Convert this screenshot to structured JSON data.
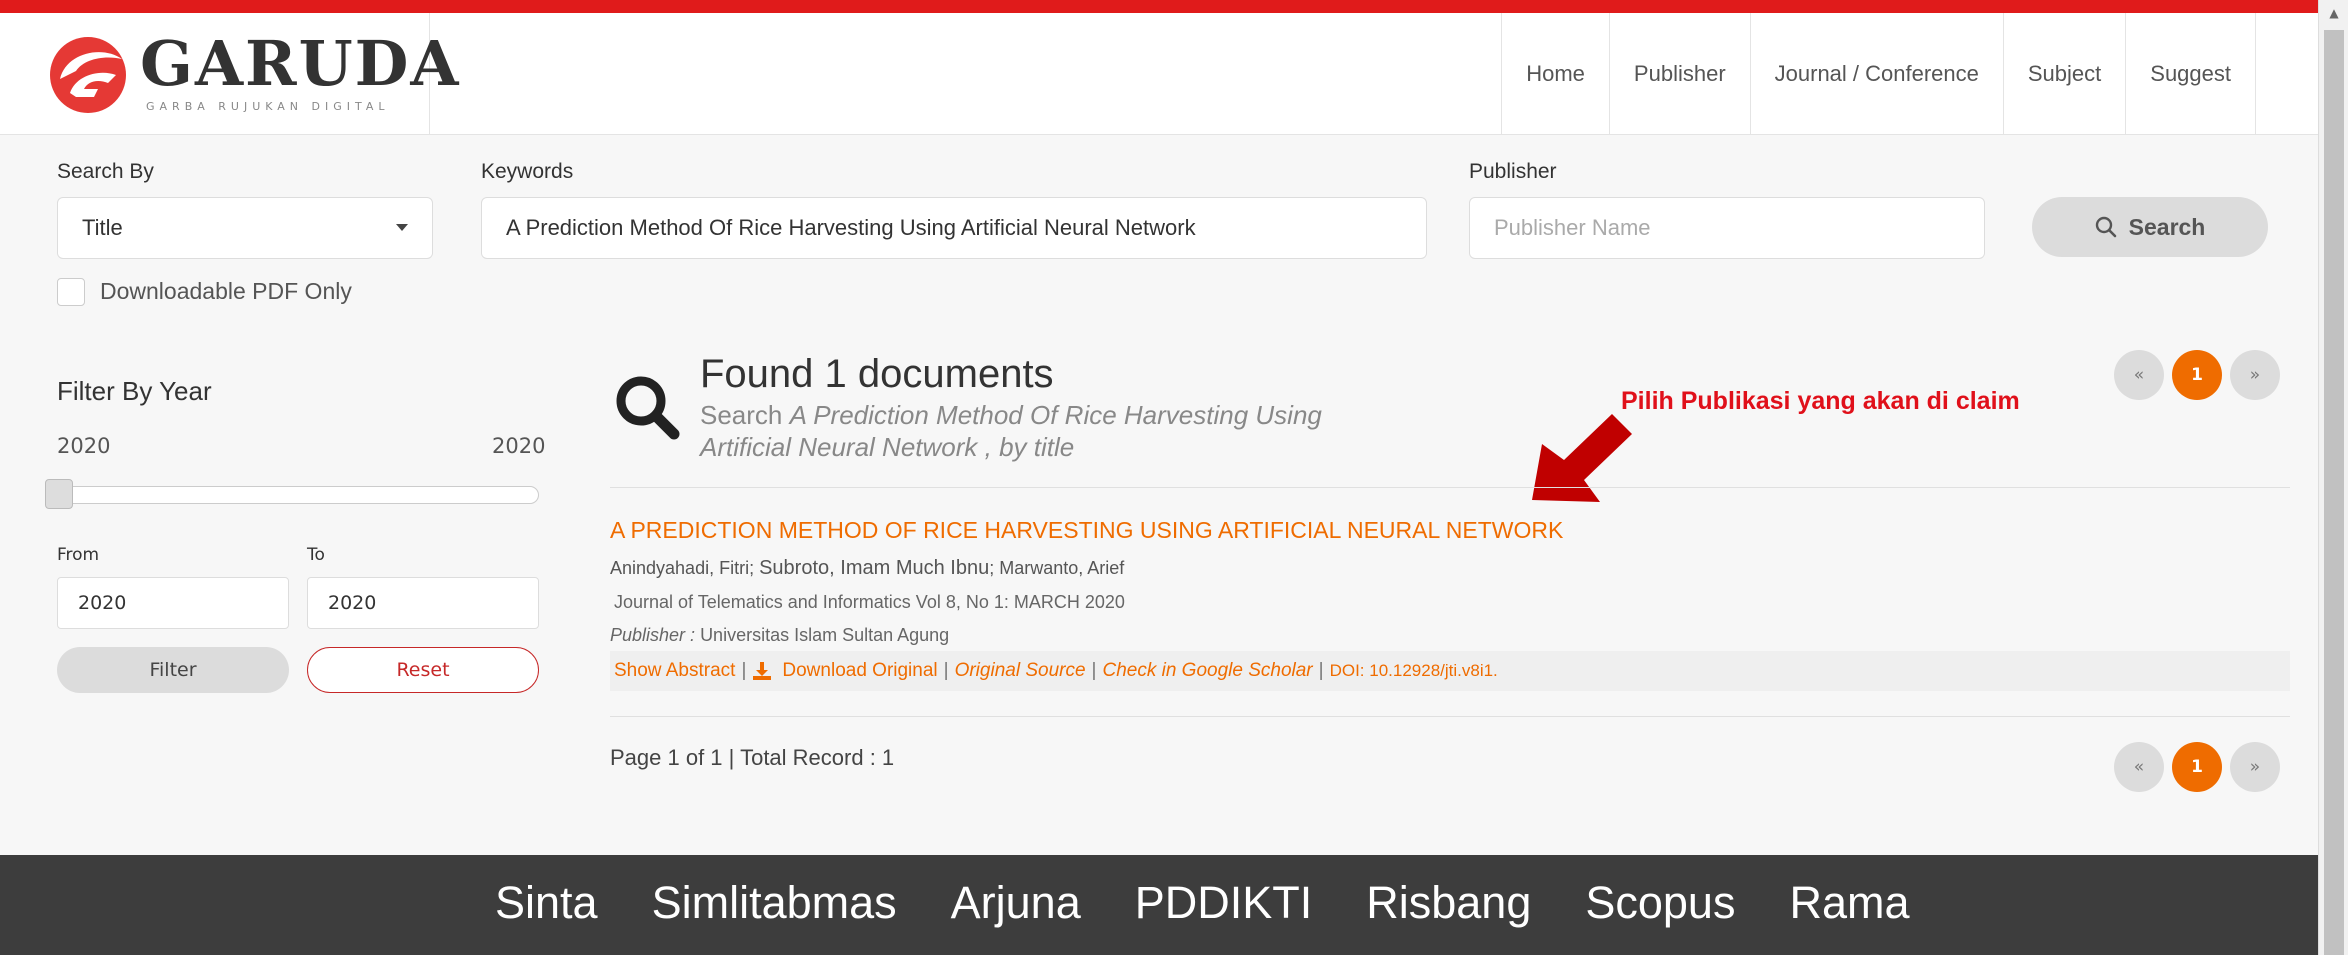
{
  "header": {
    "brand_name": "GARUDA",
    "brand_tagline": "GARBA RUJUKAN DIGITAL",
    "nav": [
      "Home",
      "Publisher",
      "Journal / Conference",
      "Subject",
      "Suggest"
    ]
  },
  "search": {
    "search_by_label": "Search By",
    "search_by_value": "Title",
    "keywords_label": "Keywords",
    "keywords_value": "A Prediction Method Of Rice Harvesting Using Artificial Neural Network",
    "publisher_label": "Publisher",
    "publisher_placeholder": "Publisher Name",
    "search_button": "Search",
    "downloadable_label": "Downloadable PDF Only"
  },
  "filter": {
    "title": "Filter By Year",
    "range_min": "2020",
    "range_max": "2020",
    "from_label": "From",
    "to_label": "To",
    "from_value": "2020",
    "to_value": "2020",
    "filter_button": "Filter",
    "reset_button": "Reset"
  },
  "results": {
    "found_title": "Found 1 documents",
    "search_prefix": "Search ",
    "search_query_line1": "A Prediction Method Of Rice Harvesting Using",
    "search_query_line2": "Artificial Neural Network , by title",
    "annotation": "Pilih Publikasi yang akan di claim",
    "pager": {
      "prev": "«",
      "current": "1",
      "next": "»"
    },
    "item": {
      "title": "A PREDICTION METHOD OF RICE HARVESTING USING ARTIFICIAL NEURAL NETWORK",
      "author1": "Anindyahadi, Fitri",
      "author2": "Subroto, Imam Much Ibnu",
      "author3": "Marwanto, Arief",
      "journal": "Journal of Telematics and Informatics Vol 8, No 1: MARCH 2020",
      "publisher_label": "Publisher :",
      "publisher_value": "Universitas Islam Sultan Agung",
      "show_abstract": "Show Abstract",
      "download_original": "Download Original",
      "original_source": "Original Source",
      "check_scholar": "Check in Google Scholar",
      "doi": "DOI: 10.12928/jti.v8i1."
    },
    "page_info": "Page 1 of 1 | Total Record : 1"
  },
  "footer": {
    "links": [
      "Sinta",
      "Simlitabmas",
      "Arjuna",
      "PDDIKTI",
      "Risbang",
      "Scopus",
      "Rama"
    ]
  },
  "colors": {
    "accent": "#ef6c00",
    "top_bar": "#e01b1b",
    "annotation": "#e0101a",
    "footer_bg": "#3d3d3d"
  }
}
